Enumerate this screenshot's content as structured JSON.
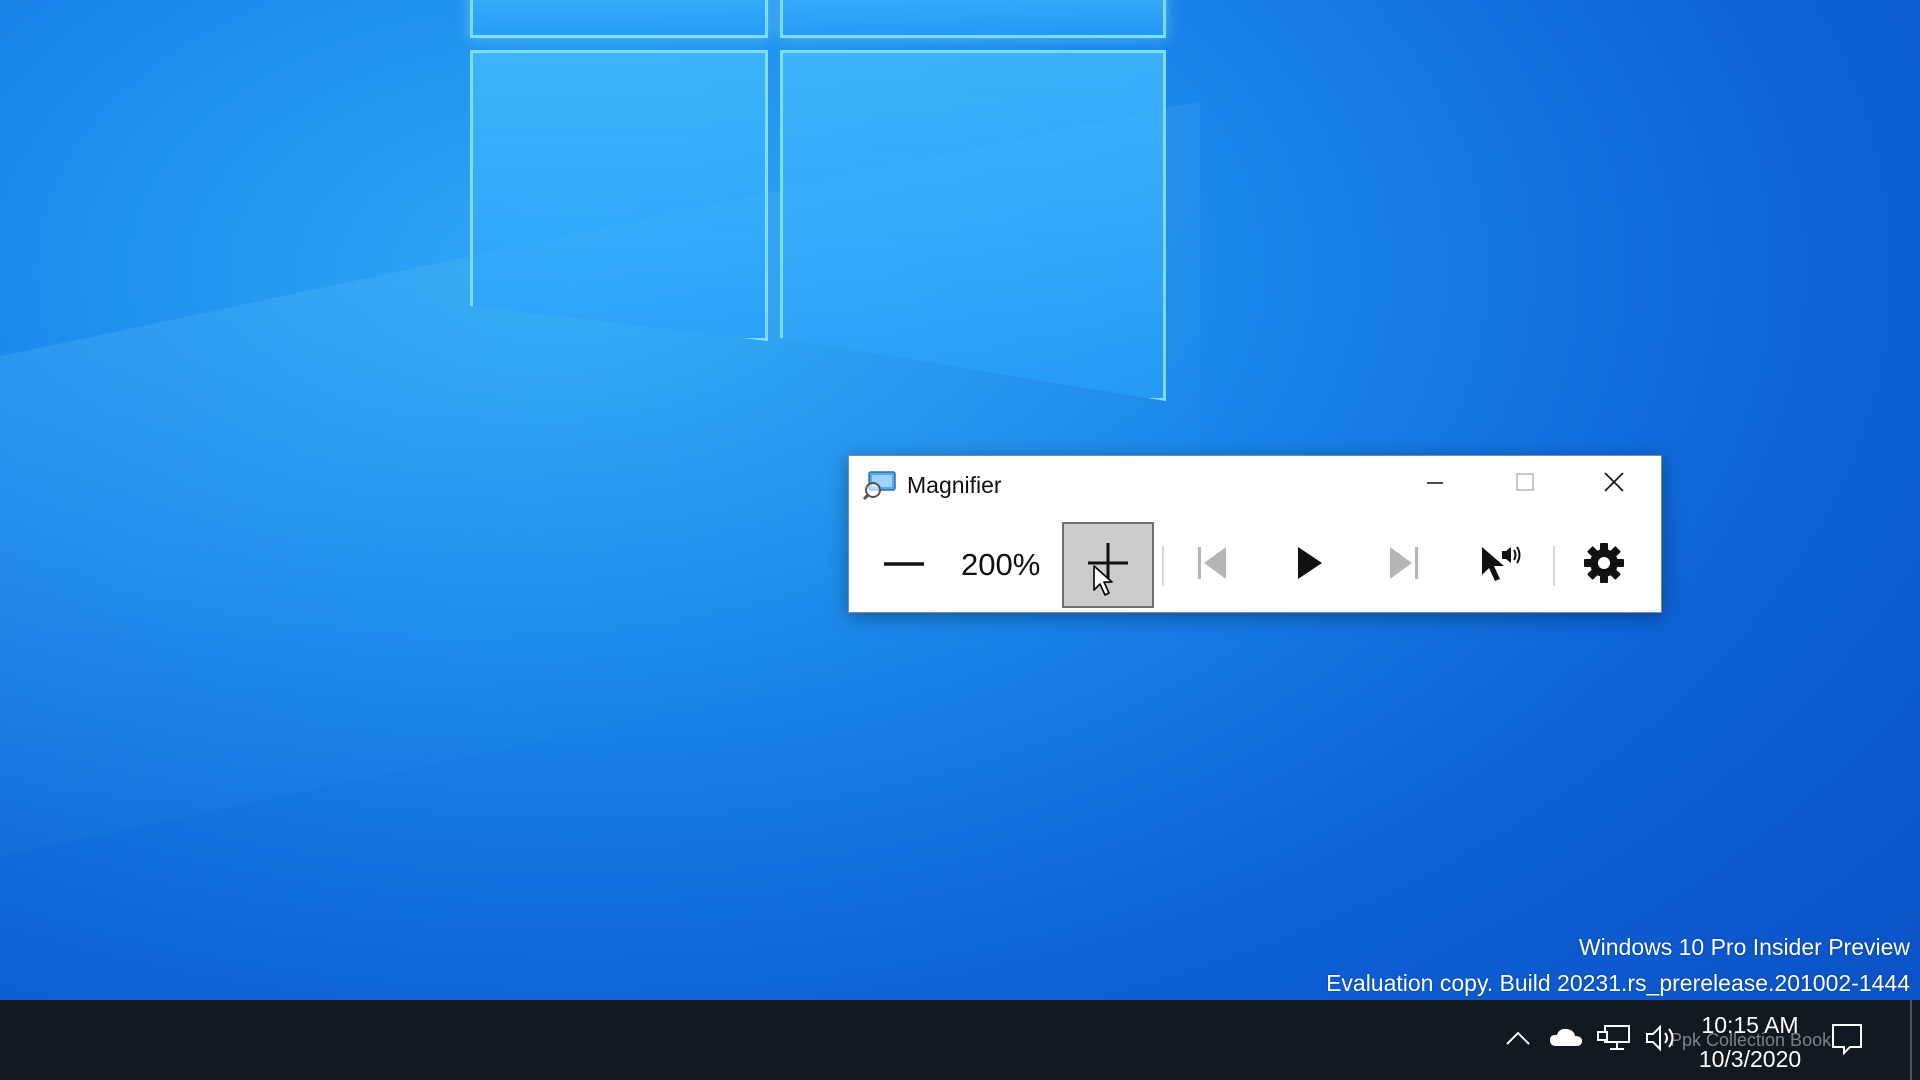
{
  "window": {
    "title": "Magnifier",
    "zoom_level": "200%",
    "icons": {
      "app": "magnifier-app-icon",
      "minimize": "minimize-icon",
      "maximize": "maximize-icon",
      "close": "close-icon",
      "zoom_out": "minus-icon",
      "zoom_in": "plus-icon",
      "previous": "skip-previous-icon",
      "play": "play-icon",
      "next": "skip-next-icon",
      "read_from_pointer": "pointer-speaker-icon",
      "settings": "gear-icon"
    }
  },
  "desktop": {
    "watermark_line1": "Windows 10 Pro Insider Preview",
    "watermark_line2": "Evaluation copy. Build 20231.rs_prerelease.201002-1444"
  },
  "taskbar": {
    "time": "10:15 AM",
    "date": "10/3/2020",
    "overlay_text": "Ppk Collection Book",
    "icons": [
      "chevron-up-icon",
      "onedrive-cloud-icon",
      "network-icon",
      "volume-icon",
      "notification-icon"
    ]
  },
  "colors": {
    "taskbar": "#101820",
    "zoom_in_pressed": "#cccccc",
    "desktop_blue": "#0d63d6"
  }
}
